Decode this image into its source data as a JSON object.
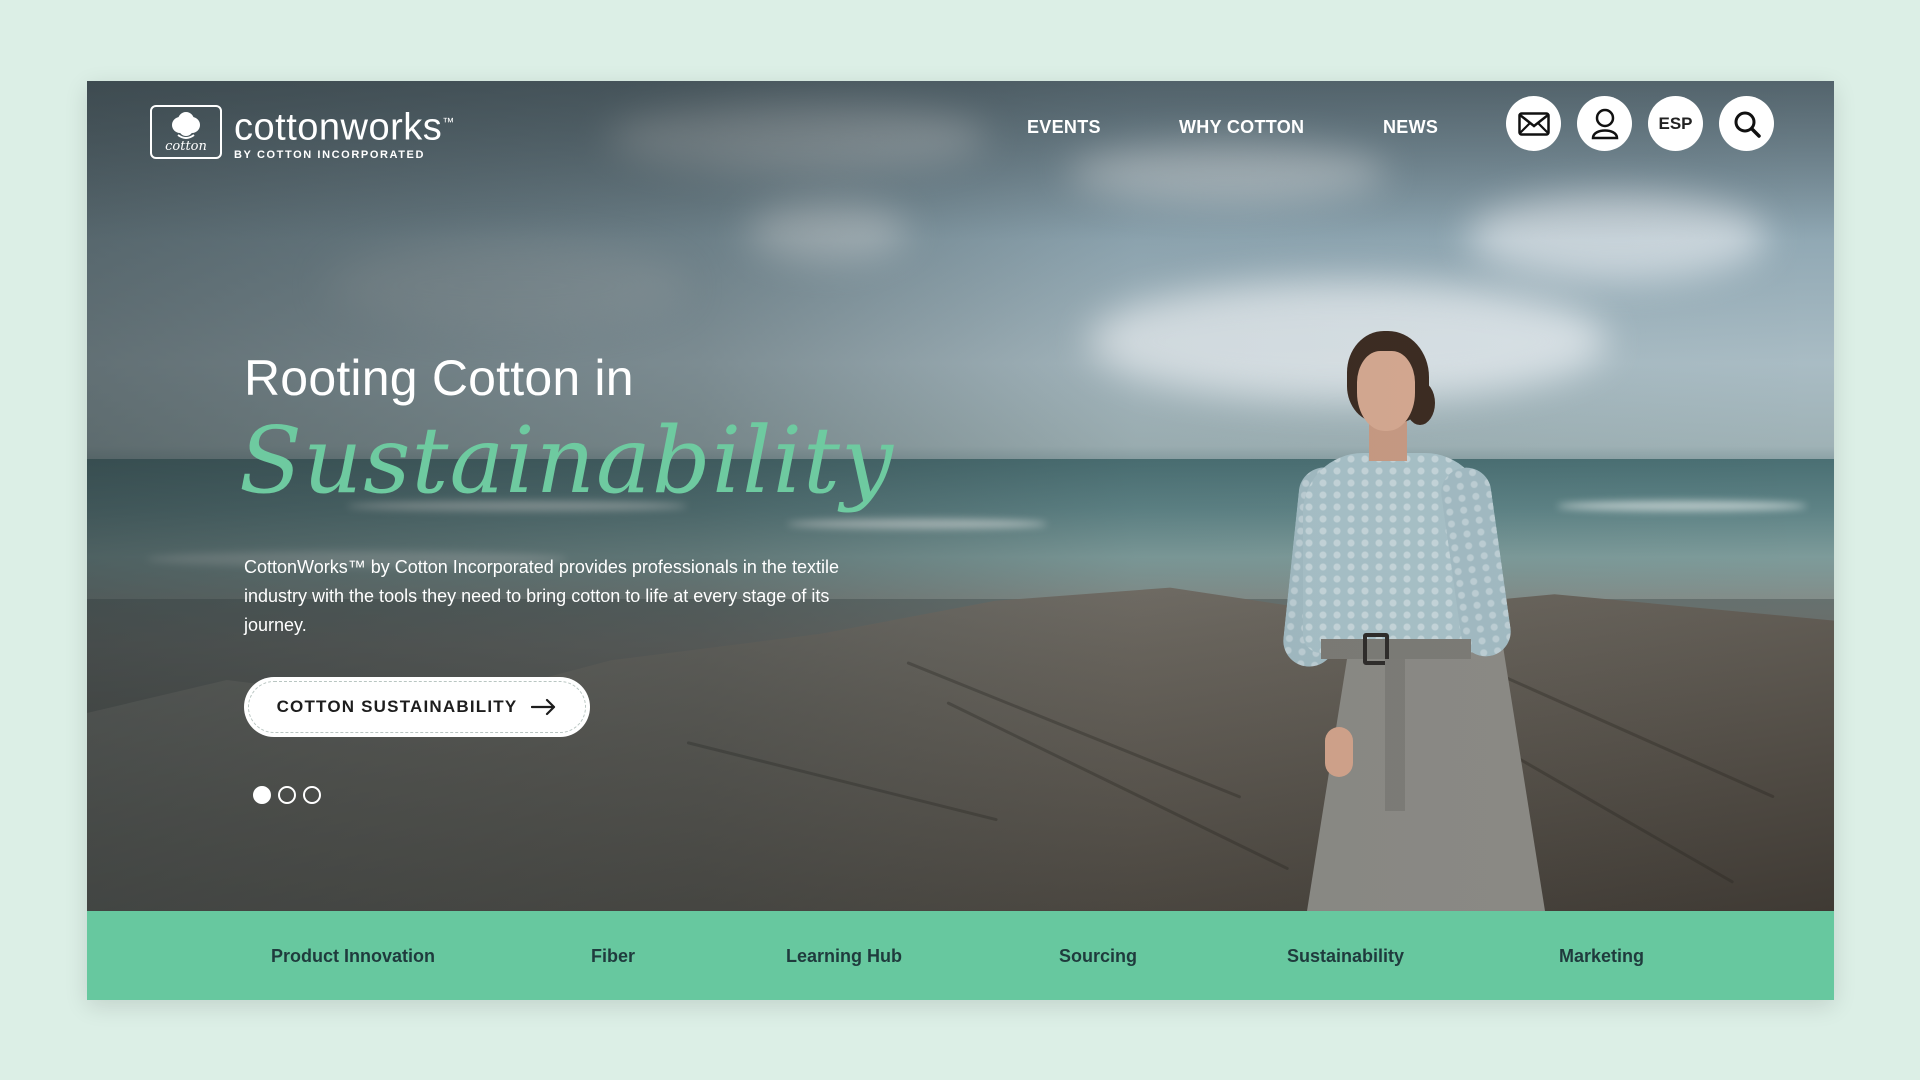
{
  "brand": {
    "mark_word": "cotton",
    "name_light": "cotton",
    "name_bold": "works",
    "trademark": "™",
    "subtitle": "BY COTTON INCORPORATED"
  },
  "nav": {
    "links": [
      {
        "label": "EVENTS"
      },
      {
        "label": "WHY COTTON"
      },
      {
        "label": "NEWS"
      }
    ],
    "icons": [
      "mail-icon",
      "user-icon",
      "language-toggle",
      "search-icon"
    ],
    "language_label": "ESP"
  },
  "hero": {
    "headline": "Rooting Cotton in",
    "script_word": "Sustainability",
    "description": "CottonWorks™ by Cotton Incorporated provides professionals in the textile industry with the tools they need to bring cotton to life at every stage of its journey.",
    "cta_label": "COTTON SUSTAINABILITY",
    "slides_total": 3,
    "active_slide": 1
  },
  "categories": [
    {
      "label": "Product Innovation"
    },
    {
      "label": "Fiber"
    },
    {
      "label": "Learning Hub"
    },
    {
      "label": "Sourcing"
    },
    {
      "label": "Sustainability"
    },
    {
      "label": "Marketing"
    }
  ],
  "colors": {
    "page_bg": "#dcefe6",
    "accent_green": "#67c89f",
    "script_green": "#6ecaa0",
    "category_text": "#1f3b3d"
  }
}
